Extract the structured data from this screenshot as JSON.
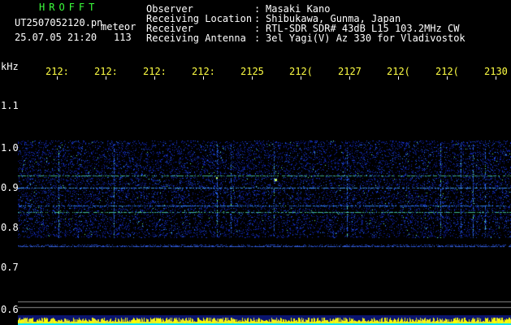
{
  "header": {
    "logo": "HROFFT",
    "file_name": "UT2507052120.pn",
    "meteor_label": "meteor",
    "date_time": "25.07.05 21:20",
    "count": "113",
    "fields": [
      {
        "label": "Observer",
        "sep": ":",
        "value": "Masaki Kano"
      },
      {
        "label": "Receiving Location",
        "sep": ":",
        "value": "Shibukawa, Gunma, Japan"
      },
      {
        "label": "Receiver",
        "sep": ":",
        "value": "RTL-SDR SDR# 43dB L15 103.2MHz CW"
      },
      {
        "label": "Receiving Antenna",
        "sep": ":",
        "value": "3el Yagi(V) Az 330 for Vladivostok"
      }
    ]
  },
  "axis": {
    "y_unit": "kHz",
    "y_ticks": [
      "1.1",
      "1.0",
      "0.9",
      "0.8",
      "0.7",
      "0.6"
    ],
    "x_ticks": [
      "212:",
      "212:",
      "212:",
      "212:",
      "2125",
      "212(",
      "2127",
      "212(",
      "212(",
      "2130"
    ]
  },
  "colors": {
    "background": "#000000",
    "header_text": "#ffffff",
    "logo": "#3cff3c",
    "time_labels": "#ffff44",
    "signal_low": "#0a1a8c",
    "signal_high": "#4dff7a",
    "activity_strip": "#ffff00"
  }
}
